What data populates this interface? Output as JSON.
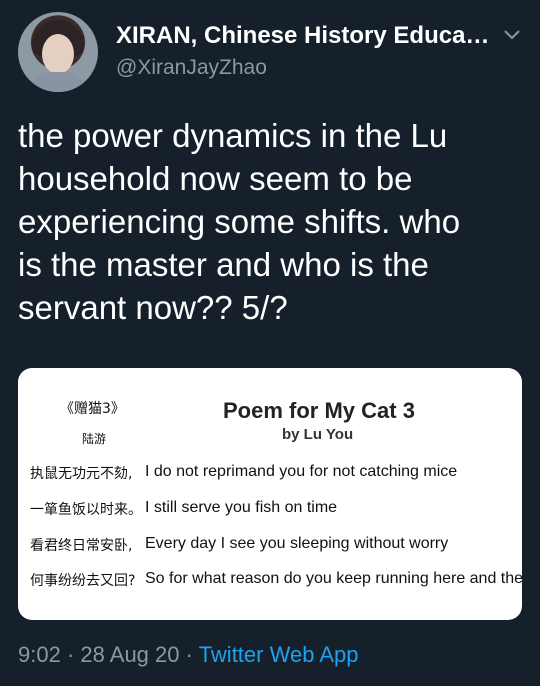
{
  "tweet": {
    "author_name": "XIRAN, Chinese History Educati…",
    "handle": "@XiranJayZhao",
    "text": "the power dynamics in the Lu\nhousehold now seem to be\nexperiencing some shifts. who\nis the master and who is the\nservant now?? 5/?",
    "time": "9:02",
    "date": "28 Aug 20",
    "separator": "·",
    "source": "Twitter Web App"
  },
  "image": {
    "title_cn": "《赠猫3》",
    "author_cn": "陆游",
    "title_en": "Poem for My Cat 3",
    "author_en": "by Lu You",
    "lines": [
      {
        "cn": "执鼠无功元不劾,",
        "en": "I do not reprimand you for not catching mice"
      },
      {
        "cn": "一箪鱼饭以时来。",
        "en": "I still serve you fish on time"
      },
      {
        "cn": "看君终日常安卧,",
        "en": "Every day I see you sleeping without worry"
      },
      {
        "cn": "何事纷纷去又回?",
        "en": "So for what reason do you keep running here and there?"
      }
    ]
  },
  "icons": {
    "menu": "chevron-down-icon"
  },
  "colors": {
    "background": "#15202b",
    "secondary_text": "#8899a6",
    "link": "#1da1f2"
  }
}
